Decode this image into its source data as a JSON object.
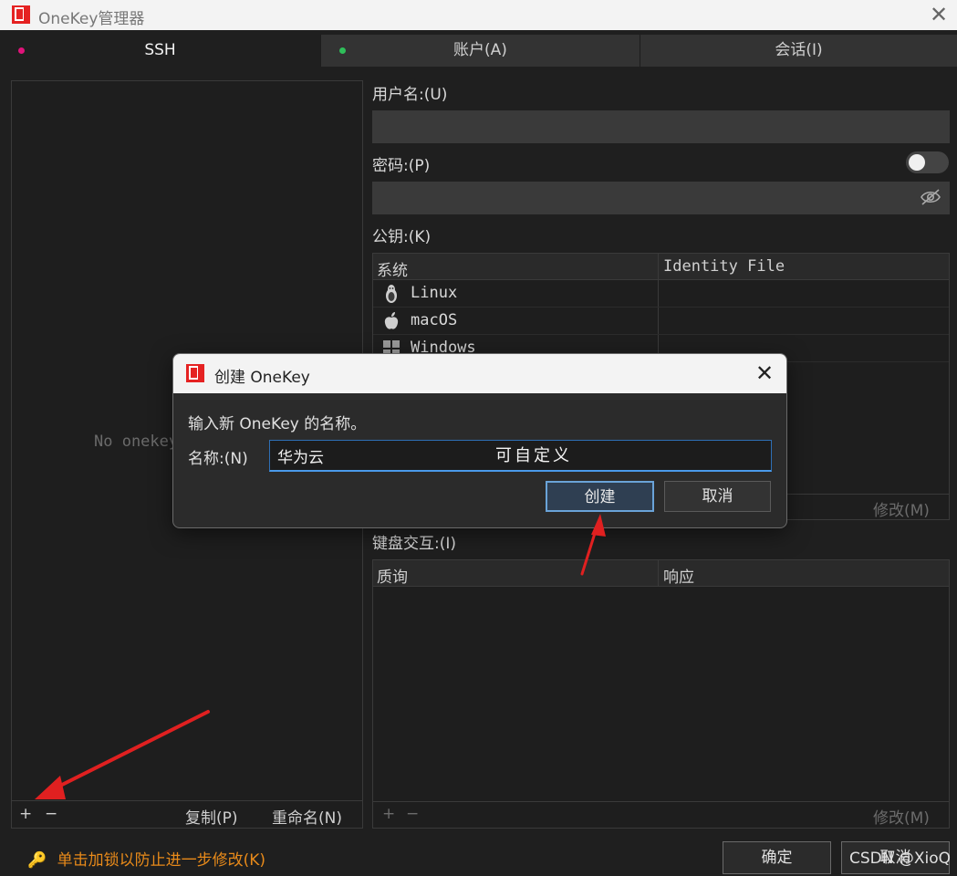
{
  "window": {
    "title": "OneKey管理器",
    "close_glyph": "✕"
  },
  "tabs": [
    {
      "label": "SSH",
      "dot_color": "#e0137a",
      "active": true
    },
    {
      "label": "账户(A)",
      "dot_color": "#2fbf5a",
      "active": false
    },
    {
      "label": "会话(I)",
      "active": false
    }
  ],
  "left_panel": {
    "empty_text": "No onekey",
    "add_label": "+",
    "remove_label": "−",
    "copy_label": "复制(P)",
    "rename_label": "重命名(N)"
  },
  "form": {
    "username_label": "用户名:(U)",
    "username_value": "",
    "password_label": "密码:(P)",
    "password_value": "",
    "password_toggle_on": false,
    "pubkey_label": "公钥:(K)",
    "keyboard_label": "键盘交互:(I)"
  },
  "pubkey_table": {
    "columns": [
      "系统",
      "Identity File"
    ],
    "rows": [
      {
        "icon": "linux-icon",
        "name": "Linux",
        "file": ""
      },
      {
        "icon": "apple-icon",
        "name": "macOS",
        "file": ""
      },
      {
        "icon": "windows-icon",
        "name": "Windows",
        "file": ""
      }
    ],
    "modify_label": "修改(M)"
  },
  "keyboard_table": {
    "columns": [
      "质询",
      "响应"
    ],
    "add_label": "+",
    "remove_label": "−",
    "modify_label": "修改(M)"
  },
  "footer": {
    "lock_text": "单击加锁以防止进一步修改(K)",
    "ok_label": "确定",
    "cancel_label": "取消",
    "watermark": "CSDN @XioQ"
  },
  "dialog": {
    "title": "创建 OneKey",
    "prompt": "输入新 OneKey 的名称。",
    "name_label": "名称:(N)",
    "name_value": "华为云",
    "annotation": "可自定义",
    "create_label": "创建",
    "cancel_label": "取消"
  },
  "colors": {
    "accent": "#4a9aea",
    "warning": "#e88a1a",
    "arrow": "#e02020"
  }
}
